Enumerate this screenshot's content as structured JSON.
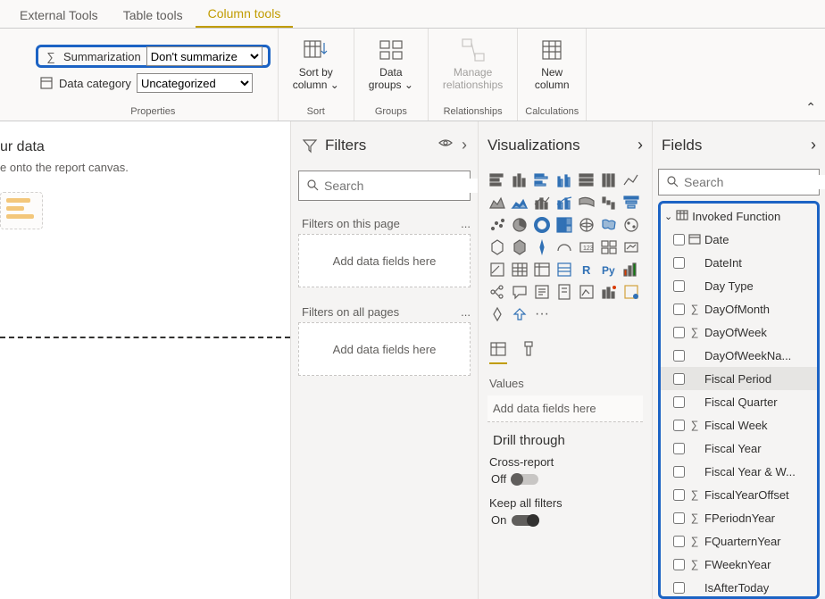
{
  "tabs": {
    "external": "External Tools",
    "table": "Table tools",
    "column": "Column tools"
  },
  "ribbon": {
    "summarization_label": "Summarization",
    "summarization_value": "Don't summarize",
    "data_category_label": "Data category",
    "data_category_value": "Uncategorized",
    "properties_label": "Properties",
    "sort_by_top": "Sort by",
    "sort_by_bottom": "column",
    "sort_label": "Sort",
    "data_groups_top": "Data",
    "data_groups_bottom": "groups",
    "groups_label": "Groups",
    "manage_top": "Manage",
    "manage_bottom": "relationships",
    "relationships_label": "Relationships",
    "new_top": "New",
    "new_bottom": "column",
    "calculations_label": "Calculations"
  },
  "canvas": {
    "title_suffix": "ur data",
    "subtitle_suffix": "e onto the report canvas."
  },
  "filters": {
    "title": "Filters",
    "search_placeholder": "Search",
    "on_page": "Filters on this page",
    "on_all": "Filters on all pages",
    "add_hint": "Add data fields here",
    "dots": "..."
  },
  "viz": {
    "title": "Visualizations",
    "values": "Values",
    "add_hint": "Add data fields here",
    "drill": "Drill through",
    "cross_report": "Cross-report",
    "off": "Off",
    "keep_filters": "Keep all filters",
    "on": "On",
    "r_label": "R",
    "py_label": "Py",
    "dots": "···"
  },
  "fields": {
    "title": "Fields",
    "search_placeholder": "Search",
    "table_name": "Invoked Function",
    "items": [
      {
        "name": "Date",
        "icon": "date",
        "sigma": false
      },
      {
        "name": "DateInt",
        "icon": "",
        "sigma": false
      },
      {
        "name": "Day Type",
        "icon": "",
        "sigma": false
      },
      {
        "name": "DayOfMonth",
        "icon": "",
        "sigma": true
      },
      {
        "name": "DayOfWeek",
        "icon": "",
        "sigma": true
      },
      {
        "name": "DayOfWeekNa...",
        "icon": "",
        "sigma": false
      },
      {
        "name": "Fiscal Period",
        "icon": "",
        "sigma": false,
        "selected": true
      },
      {
        "name": "Fiscal Quarter",
        "icon": "",
        "sigma": false
      },
      {
        "name": "Fiscal Week",
        "icon": "",
        "sigma": true
      },
      {
        "name": "Fiscal Year",
        "icon": "",
        "sigma": false
      },
      {
        "name": "Fiscal Year & W...",
        "icon": "",
        "sigma": false
      },
      {
        "name": "FiscalYearOffset",
        "icon": "",
        "sigma": true
      },
      {
        "name": "FPeriodnYear",
        "icon": "",
        "sigma": true
      },
      {
        "name": "FQuarternYear",
        "icon": "",
        "sigma": true
      },
      {
        "name": "FWeeknYear",
        "icon": "",
        "sigma": true
      },
      {
        "name": "IsAfterToday",
        "icon": "",
        "sigma": false
      }
    ]
  }
}
